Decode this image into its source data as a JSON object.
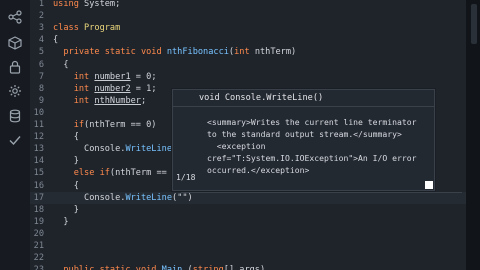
{
  "sidebar": {
    "icons": [
      "share-icon",
      "cube-icon",
      "lock-icon",
      "gear-icon",
      "database-icon",
      "check-icon"
    ]
  },
  "editor": {
    "lines": [
      {
        "n": "1",
        "parts": [
          {
            "t": "using ",
            "c": "kw"
          },
          {
            "t": "System;",
            "c": ""
          }
        ]
      },
      {
        "n": "2",
        "parts": []
      },
      {
        "n": "3",
        "parts": [
          {
            "t": "class ",
            "c": "kw"
          },
          {
            "t": "Program",
            "c": "cls"
          }
        ]
      },
      {
        "n": "4",
        "parts": [
          {
            "t": "{",
            "c": ""
          }
        ]
      },
      {
        "n": "5",
        "parts": [
          {
            "t": "  private static void ",
            "c": "kw"
          },
          {
            "t": "nthFibonacci",
            "c": "fn"
          },
          {
            "t": "(",
            "c": ""
          },
          {
            "t": "int ",
            "c": "kw"
          },
          {
            "t": "nthTerm)",
            "c": ""
          }
        ]
      },
      {
        "n": "6",
        "parts": [
          {
            "t": "  {",
            "c": ""
          }
        ]
      },
      {
        "n": "7",
        "parts": [
          {
            "t": "    int ",
            "c": "kw"
          },
          {
            "t": "number1",
            "c": "under"
          },
          {
            "t": " = 0;",
            "c": ""
          }
        ]
      },
      {
        "n": "8",
        "parts": [
          {
            "t": "    int ",
            "c": "kw"
          },
          {
            "t": "number2",
            "c": "under"
          },
          {
            "t": " = 1;",
            "c": ""
          }
        ]
      },
      {
        "n": "9",
        "parts": [
          {
            "t": "    int ",
            "c": "kw"
          },
          {
            "t": "nthNumber",
            "c": "under"
          },
          {
            "t": ";",
            "c": ""
          }
        ]
      },
      {
        "n": "10",
        "parts": []
      },
      {
        "n": "11",
        "parts": [
          {
            "t": "    if",
            "c": "kw"
          },
          {
            "t": "(nthTerm == 0)",
            "c": ""
          }
        ]
      },
      {
        "n": "12",
        "parts": [
          {
            "t": "    {",
            "c": ""
          }
        ]
      },
      {
        "n": "13",
        "parts": [
          {
            "t": "      Console.",
            "c": ""
          },
          {
            "t": "WriteLine",
            "c": "fn"
          },
          {
            "t": "(\"",
            "c": ""
          }
        ]
      },
      {
        "n": "14",
        "parts": [
          {
            "t": "    }",
            "c": ""
          }
        ]
      },
      {
        "n": "15",
        "parts": [
          {
            "t": "    else if",
            "c": "kw"
          },
          {
            "t": "(nthTerm == 1)",
            "c": ""
          }
        ]
      },
      {
        "n": "16",
        "parts": [
          {
            "t": "    {",
            "c": ""
          }
        ]
      },
      {
        "n": "17",
        "parts": [
          {
            "t": "      Console.",
            "c": ""
          },
          {
            "t": "WriteLine",
            "c": "fn"
          },
          {
            "t": "(\"\")",
            "c": ""
          }
        ]
      },
      {
        "n": "18",
        "parts": [
          {
            "t": "    }",
            "c": ""
          }
        ]
      },
      {
        "n": "19",
        "parts": [
          {
            "t": "  }",
            "c": ""
          }
        ]
      },
      {
        "n": "20",
        "parts": []
      },
      {
        "n": "21",
        "parts": []
      },
      {
        "n": "22",
        "parts": []
      },
      {
        "n": "23",
        "parts": [
          {
            "t": "  public static void ",
            "c": "kw"
          },
          {
            "t": "Main",
            "c": "fn"
          },
          {
            "t": " (",
            "c": ""
          },
          {
            "t": "string",
            "c": "kw"
          },
          {
            "t": "[] args)",
            "c": ""
          }
        ]
      }
    ]
  },
  "tooltip": {
    "signature": "void Console.WriteLine()",
    "doc": "<summary>Writes the current line terminator to the standard output stream.</summary>\n  <exception cref=\"T:System.IO.IOException\">An I/O error occurred.</exception>",
    "counter": "1/18"
  }
}
